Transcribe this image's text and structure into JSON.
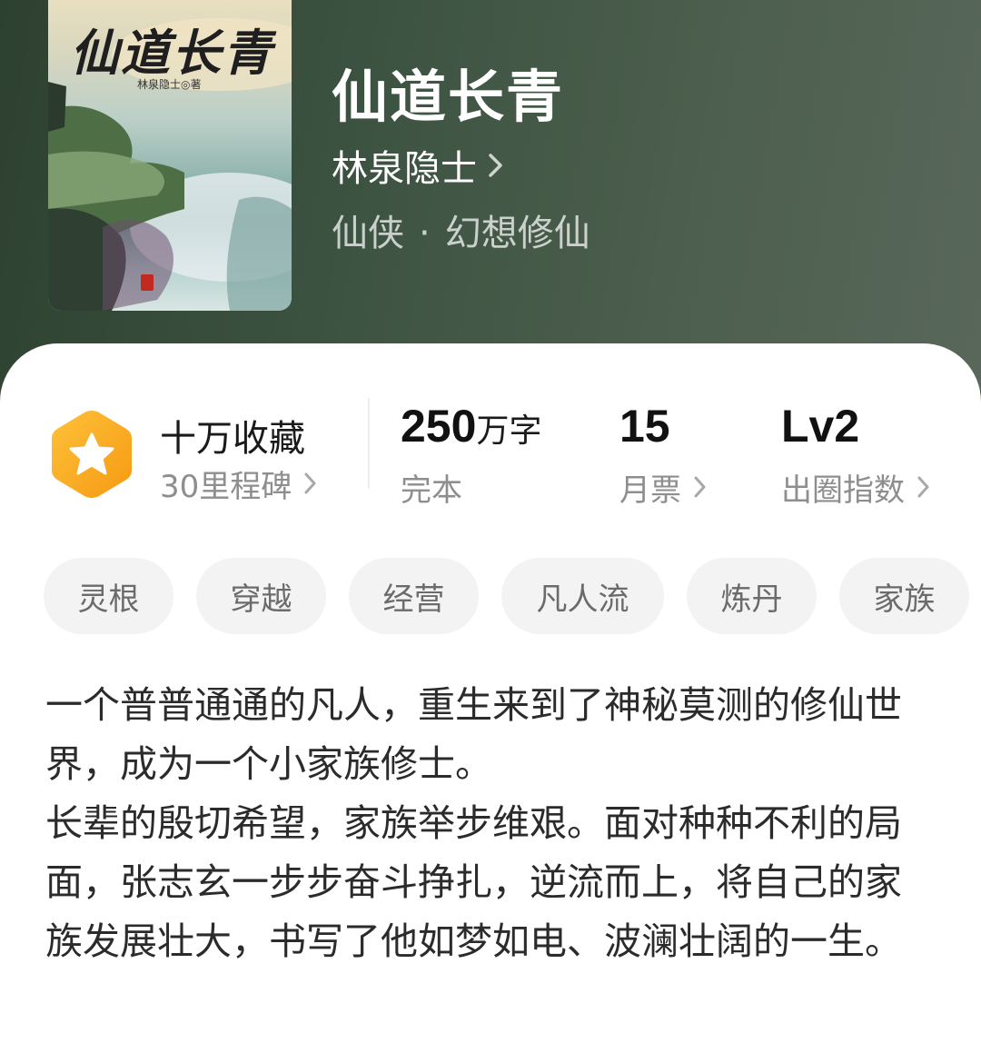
{
  "book": {
    "cover_title": "仙道长青",
    "cover_author": "林泉隐士◎著",
    "title": "仙道长青",
    "author": "林泉隐士",
    "genre_primary": "仙侠",
    "genre_separator": "·",
    "genre_secondary": "幻想修仙"
  },
  "stats": {
    "collection": {
      "label": "十万收藏",
      "sub": "30里程碑",
      "icon": "star-hexagon-icon"
    },
    "words": {
      "value": "250",
      "unit": "万字",
      "sub": "完本"
    },
    "monthly_tickets": {
      "value": "15",
      "sub": "月票"
    },
    "popularity": {
      "value": "Lv2",
      "sub": "出圈指数"
    }
  },
  "tags": [
    "灵根",
    "穿越",
    "经营",
    "凡人流",
    "炼丹",
    "家族"
  ],
  "synopsis": {
    "paragraph1": "一个普普通通的凡人，重生来到了神秘莫测的修仙世界，成为一个小家族修士。",
    "paragraph2": "长辈的殷切希望，家族举步维艰。面对种种不利的局面，张志玄一步步奋斗挣扎，逆流而上，将自己的家族发展壮大，书写了他如梦如电、波澜壮阔的一生。"
  },
  "colors": {
    "header_bg": "#3c5240",
    "badge_orange": "#f7a21b",
    "text_primary": "#1a1a1a",
    "text_secondary": "#8e8e8e",
    "tag_bg": "#f3f3f3"
  }
}
